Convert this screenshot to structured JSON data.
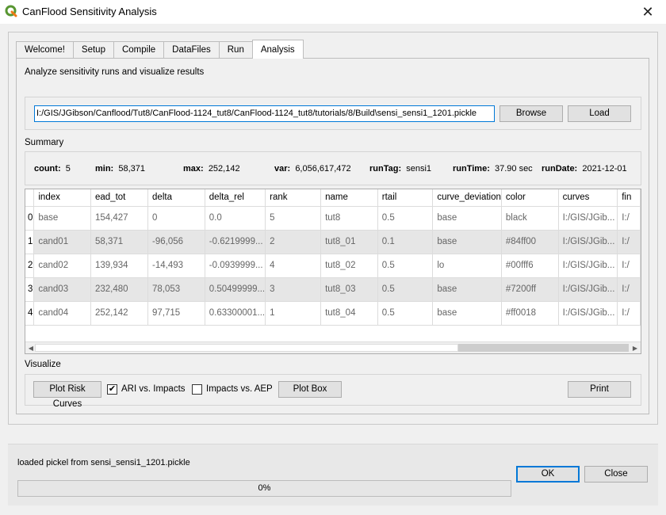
{
  "window": {
    "title": "CanFlood Sensitivity Analysis",
    "close_glyph": "✕"
  },
  "tabs": [
    "Welcome!",
    "Setup",
    "Compile",
    "DataFiles",
    "Run",
    "Analysis"
  ],
  "active_tab": "Analysis",
  "analysis": {
    "description": "Analyze sensitivity runs and visualize results",
    "path_value": "I:/GIS/JGibson/Canflood/Tut8/CanFlood-1124_tut8/CanFlood-1124_tut8/tutorials/8/Build\\sensi_sensi1_1201.pickle",
    "browse_label": "Browse",
    "load_label": "Load"
  },
  "summary": {
    "label": "Summary",
    "items": [
      {
        "key": "count:",
        "value": "5"
      },
      {
        "key": "min:",
        "value": "58,371"
      },
      {
        "key": "max:",
        "value": "252,142"
      },
      {
        "key": "var:",
        "value": "6,056,617,472"
      },
      {
        "key": "runTag:",
        "value": "sensi1"
      },
      {
        "key": "runTime:",
        "value": "37.90 sec"
      },
      {
        "key": "runDate:",
        "value": "2021-12-01"
      }
    ]
  },
  "table": {
    "headers": [
      "index",
      "ead_tot",
      "delta",
      "delta_rel",
      "rank",
      "name",
      "rtail",
      "curve_deviation",
      "color",
      "curves",
      "fin"
    ],
    "rows": [
      {
        "row_header": "0",
        "cells": [
          "base",
          "154,427",
          "0",
          "0.0",
          "5",
          "tut8",
          "0.5",
          "base",
          "black",
          "I:/GIS/JGib...",
          "I:/"
        ]
      },
      {
        "row_header": "1",
        "cells": [
          "cand01",
          "58,371",
          "-96,056",
          "-0.6219999...",
          "2",
          "tut8_01",
          "0.1",
          "base",
          "#84ff00",
          "I:/GIS/JGib...",
          "I:/"
        ]
      },
      {
        "row_header": "2",
        "cells": [
          "cand02",
          "139,934",
          "-14,493",
          "-0.0939999...",
          "4",
          "tut8_02",
          "0.5",
          "lo",
          "#00fff6",
          "I:/GIS/JGib...",
          "I:/"
        ]
      },
      {
        "row_header": "3",
        "cells": [
          "cand03",
          "232,480",
          "78,053",
          "0.50499999...",
          "3",
          "tut8_03",
          "0.5",
          "base",
          "#7200ff",
          "I:/GIS/JGib...",
          "I:/"
        ]
      },
      {
        "row_header": "4",
        "cells": [
          "cand04",
          "252,142",
          "97,715",
          "0.63300001...",
          "1",
          "tut8_04",
          "0.5",
          "base",
          "#ff0018",
          "I:/GIS/JGib...",
          "I:/"
        ]
      }
    ]
  },
  "visualize": {
    "label": "Visualize",
    "plot_risk_curves_label": "Plot Risk Curves",
    "ari_vs_impacts_label": "ARI vs. Impacts",
    "ari_vs_impacts_checked": true,
    "impacts_vs_aep_label": "Impacts vs. AEP",
    "impacts_vs_aep_checked": false,
    "plot_box_label": "Plot Box",
    "print_label": "Print"
  },
  "status": {
    "message": "loaded pickel from sensi_sensi1_1201.pickle",
    "progress_percent": 0,
    "progress_text": "0%"
  },
  "dialog_buttons": {
    "ok_label": "OK",
    "close_label": "Close"
  },
  "colors": {
    "qgis_green": "#589632",
    "accent_blue": "#0078d7",
    "alt_row": "#e6e6e6"
  }
}
